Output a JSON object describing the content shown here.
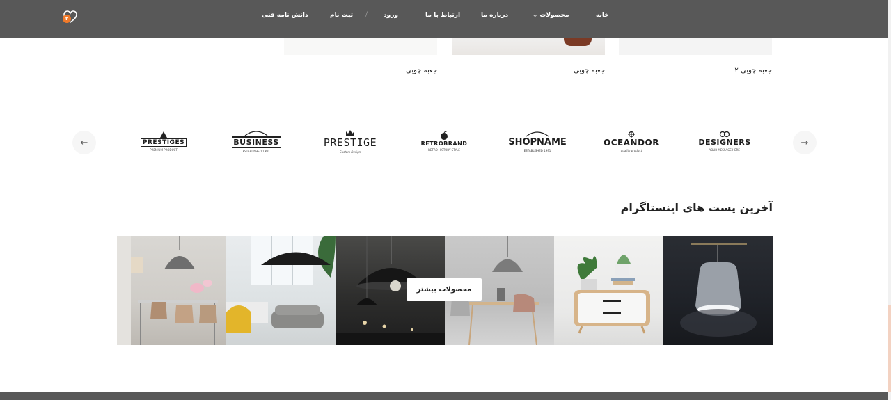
{
  "header": {
    "nav": [
      {
        "label": "خانه"
      },
      {
        "label": "محصولات"
      },
      {
        "label": "درباره ما"
      },
      {
        "label": "ارتباط با ما"
      },
      {
        "label": "ورود"
      },
      {
        "label": "ثبت نام"
      },
      {
        "label": "دانش نامه فنی"
      }
    ],
    "separator": "/",
    "cart_count": "۳",
    "cart_icon": "heart-cart-icon"
  },
  "products": [
    {
      "title": "جعبه چوبی ۲"
    },
    {
      "title": "جعبه چوبی"
    },
    {
      "title": "جعبه چوبی"
    }
  ],
  "brands": {
    "prev_icon": "arrow-left-icon",
    "next_icon": "arrow-right-icon",
    "prev_glyph": "←",
    "next_glyph": "→",
    "logos": [
      {
        "name": "DESIGNERS",
        "sub": "YOUR MESSAGE HERE"
      },
      {
        "name": "OCEANDOR",
        "sub": "quality product"
      },
      {
        "name": "SHOPNAME",
        "sub": "ESTABLISHED 1991"
      },
      {
        "name": "RETROBRAND",
        "sub": "RETRO HISTORY STYLE"
      },
      {
        "name": "PRESTIGE",
        "sub": "Custom Design"
      },
      {
        "name": "BUSINESS",
        "sub": "ESTABLISHED 1991"
      },
      {
        "name": "PRESTIGES",
        "sub": "PREMIUM PRODUCT"
      }
    ]
  },
  "instagram": {
    "title": "آخرین پست های اینستاگرام",
    "more_label": "محصولات بیشتر"
  },
  "colors": {
    "header_bg": "#585858",
    "accent": "#f07a2a"
  }
}
